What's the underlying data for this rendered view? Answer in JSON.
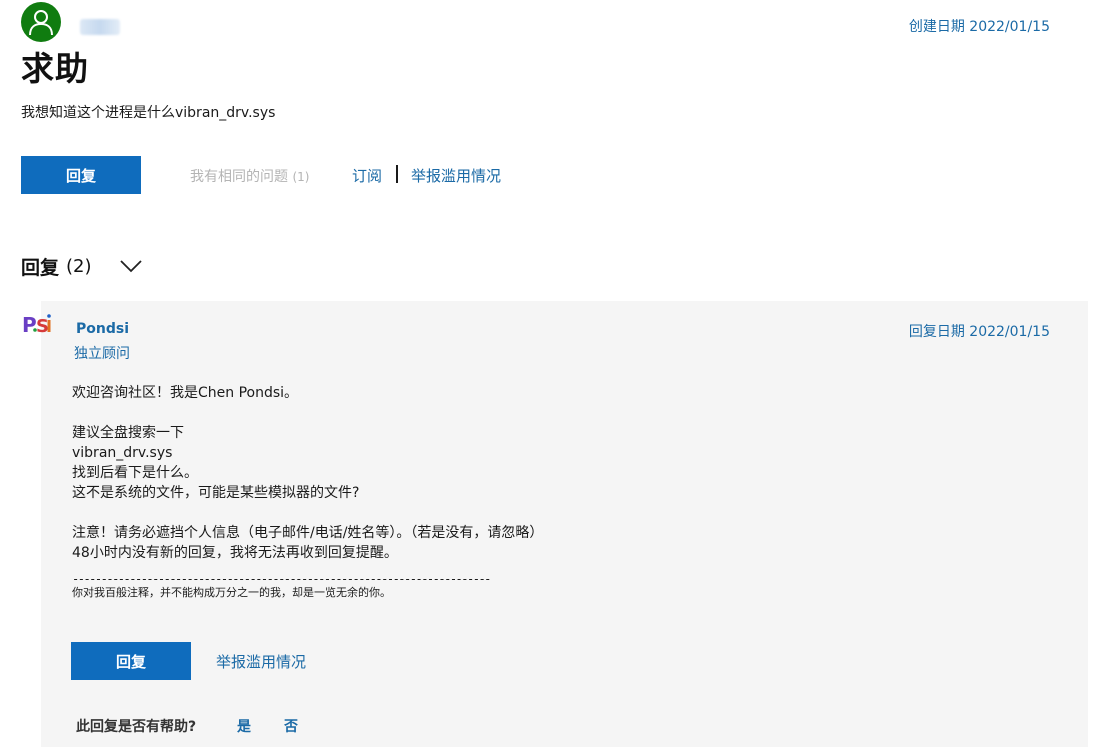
{
  "question": {
    "created_label": "创建日期 2022/01/15",
    "title": "求助",
    "body": "我想知道这个进程是什么vibran_drv.sys",
    "actions": {
      "reply_label": "回复",
      "same_question_label": "我有相同的问题",
      "same_question_count": "(1)",
      "subscribe_label": "订阅",
      "report_label": "举报滥用情况"
    }
  },
  "replies": {
    "title": "回复",
    "count": "(2)"
  },
  "reply": {
    "author": "Pondsi",
    "avatar_text": "P.Si",
    "role": "独立顾问",
    "date_label": "回复日期 2022/01/15",
    "body": {
      "line1": "欢迎咨询社区！我是Chen Pondsi。",
      "line2": "建议全盘搜索一下",
      "line3": "vibran_drv.sys",
      "line4": "找到后看下是什么。",
      "line5": "这不是系统的文件，可能是某些模拟器的文件?",
      "line6": "注意！请务必遮挡个人信息（电子邮件/电话/姓名等）。（若是没有，请忽略）",
      "line7": "48小时内没有新的回复，我将无法再收到回复提醒。",
      "separator": "-------------------------------------------------------------------------",
      "signature": "你对我百般注释，并不能构成万分之一的我，却是一览无余的你。"
    },
    "actions": {
      "reply_label": "回复",
      "report_label": "举报滥用情况"
    },
    "helpful": {
      "question": "此回复是否有帮助?",
      "yes": "是",
      "no": "否"
    }
  },
  "colors": {
    "primary": "#0f6cbd",
    "link": "#1b6aa6",
    "avatar_bg": "#107c10",
    "card_bg": "#f5f5f5"
  }
}
